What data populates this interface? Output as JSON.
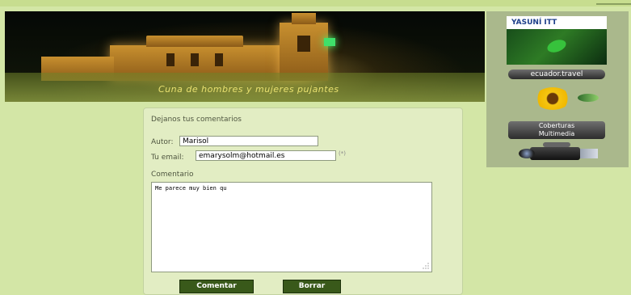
{
  "banner": {
    "tagline": "Cuna de hombres y mujeres pujantes"
  },
  "sidebar": {
    "yasuni_logo": "YASUNÍ ITT",
    "ecuador_travel": "ecuador.travel",
    "coberturas_line1": "Coberturas",
    "coberturas_line2": "Multimedia"
  },
  "form": {
    "heading": "Dejanos tus comentarios",
    "author_label": "Autor:",
    "author_value": "Marisol",
    "email_label": "Tu email:",
    "email_value": "emarysolm@hotmail.es",
    "email_required_mark": "(*)",
    "comment_label": "Comentario",
    "comment_value": "Me parece muy bien qu",
    "submit_label": "Comentar",
    "clear_label": "Borrar"
  },
  "colors": {
    "page_bg": "#d3e6a6",
    "panel_bg": "#e2edc3",
    "button_bg": "#39591a",
    "sidebar_bg": "#aab88c"
  },
  "icons": {
    "frog": "frog-icon",
    "sunflower": "sunflower-icon",
    "camera": "video-camera-icon",
    "resize": "resize-grip-icon"
  }
}
